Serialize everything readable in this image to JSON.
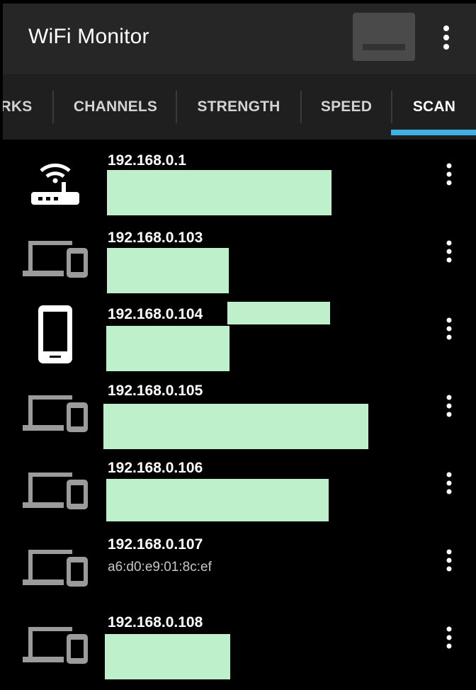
{
  "app": {
    "title": "WiFi Monitor"
  },
  "tabs": [
    {
      "label": "RKS",
      "active": false
    },
    {
      "label": "CHANNELS",
      "active": false
    },
    {
      "label": "STRENGTH",
      "active": false
    },
    {
      "label": "SPEED",
      "active": false
    },
    {
      "label": "SCAN",
      "active": true
    }
  ],
  "colors": {
    "accent": "#3eb0e3",
    "redaction": "#bdf0cb",
    "appbar": "#262626"
  },
  "devices": [
    {
      "ip": "192.168.0.1",
      "icon": "router-icon"
    },
    {
      "ip": "192.168.0.103",
      "icon": "devices-icon"
    },
    {
      "ip": "192.168.0.104",
      "icon": "phone-icon"
    },
    {
      "ip": "192.168.0.105",
      "icon": "devices-icon"
    },
    {
      "ip": "192.168.0.106",
      "icon": "devices-icon"
    },
    {
      "ip": "192.168.0.107",
      "icon": "devices-icon",
      "mac": "a6:d0:e9:01:8c:ef"
    },
    {
      "ip": "192.168.0.108",
      "icon": "devices-icon"
    }
  ]
}
